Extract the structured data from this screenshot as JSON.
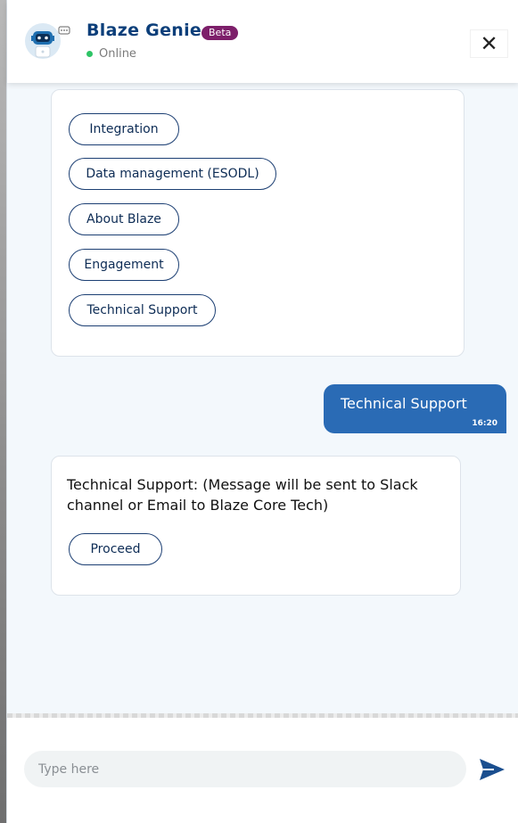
{
  "header": {
    "bot_name": "Blaze Genie",
    "badge": "Beta",
    "status": "Online",
    "close_icon": "close-icon",
    "close_glyph": "✕"
  },
  "messages": {
    "options": [
      "Integration",
      "Data management (ESODL)",
      "About Blaze",
      "Engagement",
      "Technical Support"
    ],
    "user_message": {
      "text": "Technical Support",
      "time": "16:20"
    },
    "bot_reply": {
      "text": "Technical Support: (Message will be sent to Slack channel or Email to Blaze Core Tech)",
      "button": "Proceed"
    }
  },
  "composer": {
    "placeholder": "Type here",
    "send_icon": "send-icon"
  },
  "colors": {
    "brand": "#0c3f7a",
    "badge": "#7d1f6a",
    "user_bubble": "#2a6bb5",
    "online": "#2ec466"
  }
}
